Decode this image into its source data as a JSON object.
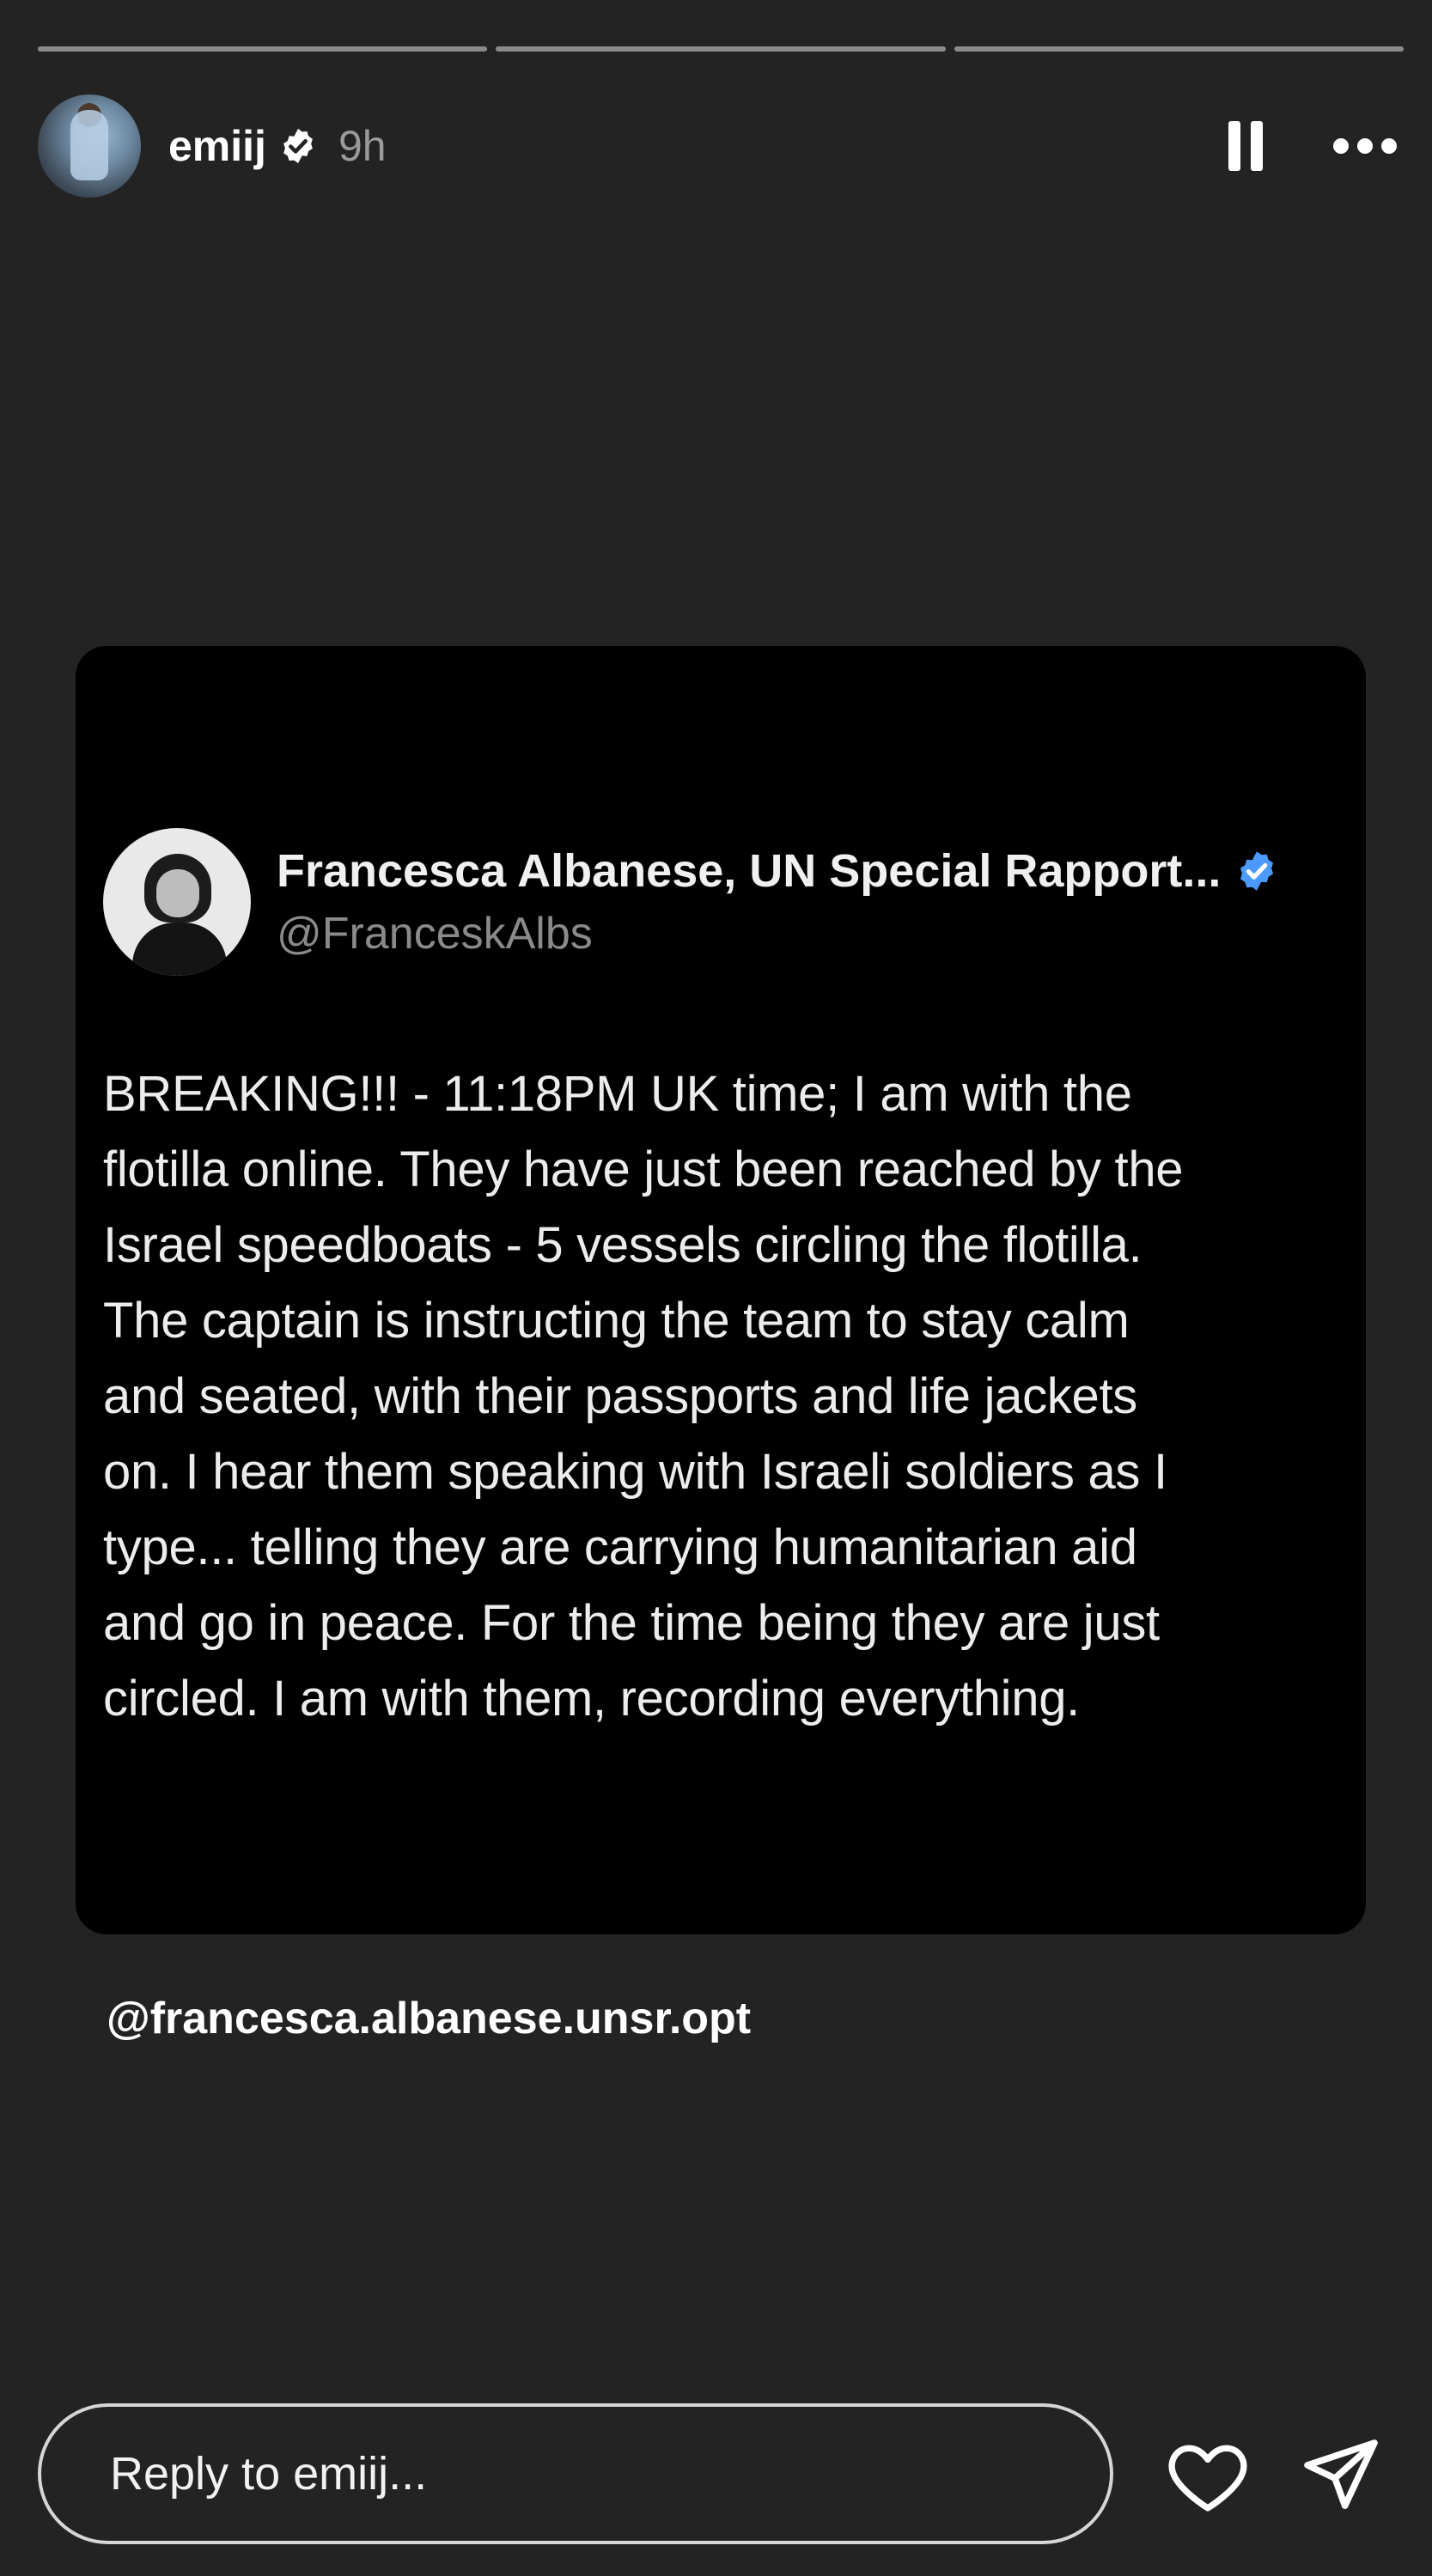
{
  "story": {
    "progress": [
      1.0,
      1.0,
      1.0
    ],
    "username": "emiij",
    "timestamp": "9h",
    "is_verified": true
  },
  "header": {
    "pause_icon": "pause-icon",
    "more_icon": "more-horizontal-icon"
  },
  "tweet": {
    "display_name": "Francesca Albanese, UN Special Rapport...",
    "handle": "@FranceskAlbs",
    "verified_color": "#4c9aff",
    "body": "BREAKING!!! - 11:18PM UK time; I am with the\nflotilla online. They have just been reached by the\nIsrael speedboats - 5 vessels circling the flotilla.\nThe captain is instructing the team to stay calm\nand seated, with their passports and life jackets\non. I hear them speaking with Israeli soldiers as I\ntype... telling they are carrying humanitarian aid\nand go in peace. For the time being they are just\ncircled. I am with them, recording everything."
  },
  "mention": "@francesca.albanese.unsr.opt",
  "footer": {
    "reply_placeholder": "Reply to emiij...",
    "like_icon": "heart-icon",
    "share_icon": "send-icon"
  },
  "colors": {
    "background": "#232323",
    "card": "#000000",
    "accent_verified": "#4c9aff"
  }
}
